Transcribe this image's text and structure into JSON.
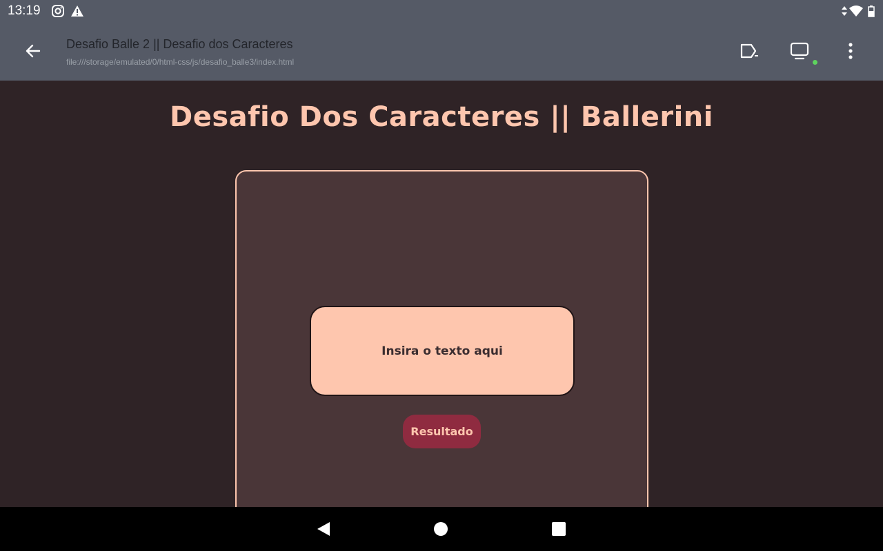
{
  "status_bar": {
    "time": "13:19",
    "icons": [
      "instagram-icon",
      "warning-icon",
      "data-arrows-icon",
      "wifi-icon",
      "battery-icon"
    ]
  },
  "toolbar": {
    "title": "Desafio Balle 2 || Desafio dos Caracteres",
    "url": "file:///storage/emulated/0/html-css/js/desafio_balle3/index.html",
    "icons": [
      "back-arrow-icon",
      "console-icon",
      "monitor-icon",
      "more-vertical-icon"
    ],
    "status_dot_color": "#5ed35e"
  },
  "page": {
    "heading": "Desafio Dos Caracteres || Ballerini",
    "input": {
      "placeholder": "Insira o texto aqui",
      "value": ""
    },
    "button_label": "Resultado"
  },
  "nav_bar": {
    "icons": [
      "nav-back-icon",
      "nav-home-icon",
      "nav-recents-icon"
    ]
  },
  "colors": {
    "background": "#2f2326",
    "card": "#4a3638",
    "accent": "#fec6ae",
    "button": "#8f2b40",
    "chrome": "#555a66"
  }
}
